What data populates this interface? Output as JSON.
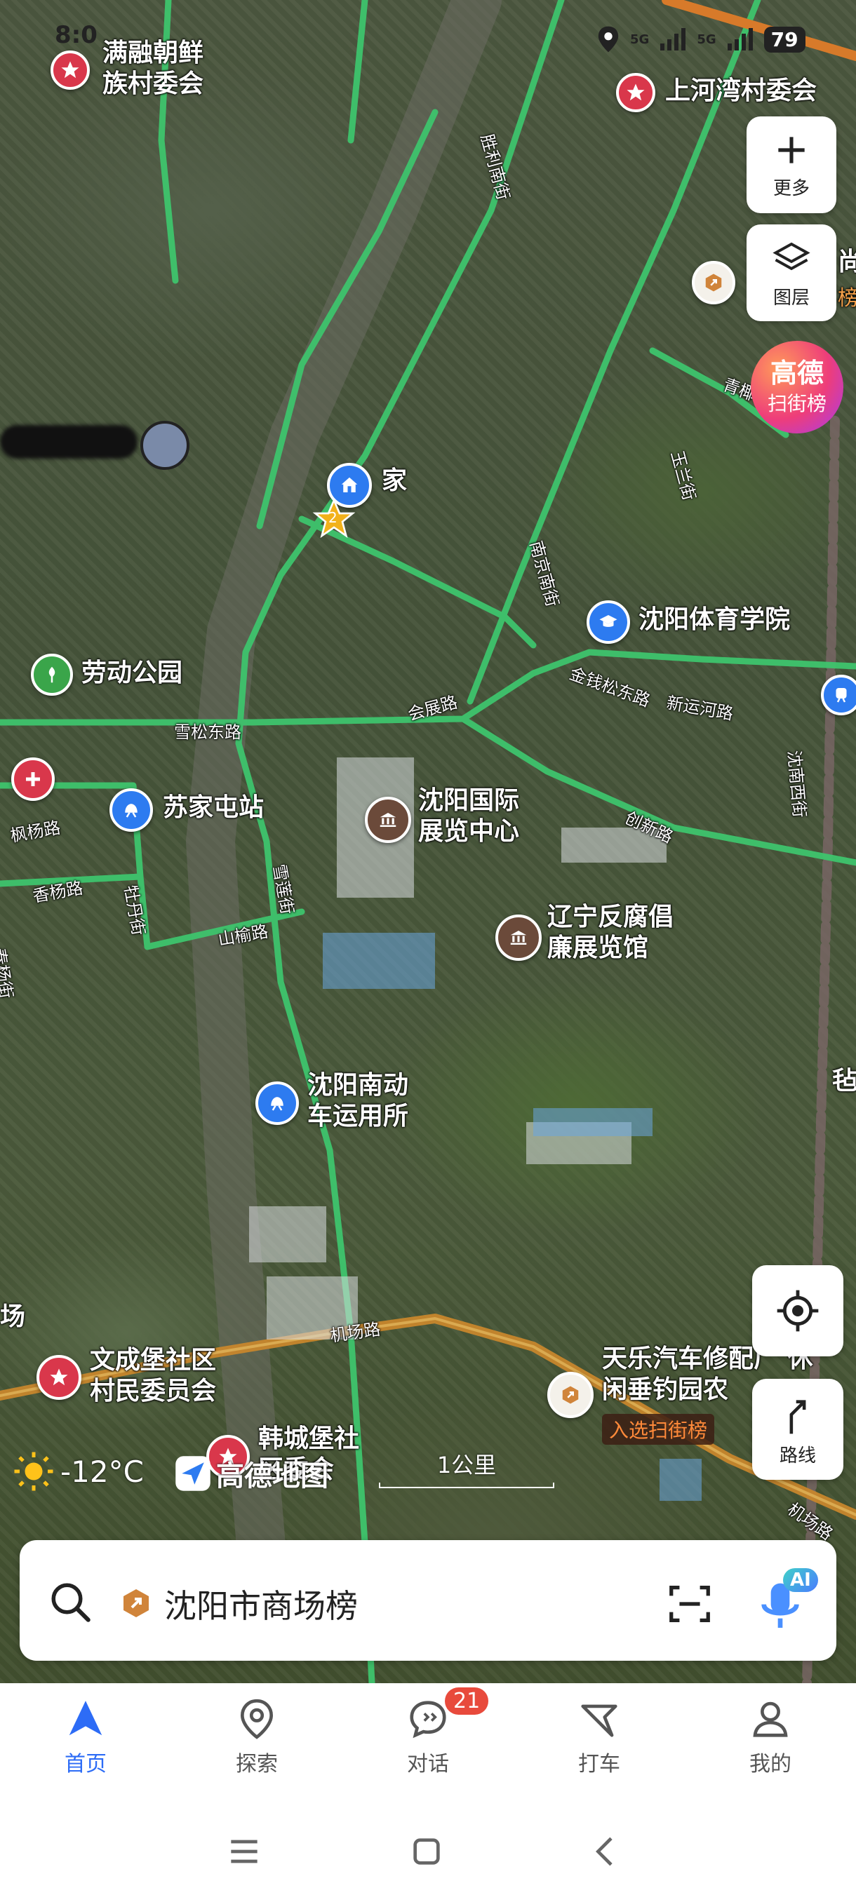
{
  "status_bar": {
    "time": "8:0",
    "signal_labels": [
      "5G",
      "5G"
    ],
    "battery": "79"
  },
  "map_controls": {
    "more_label": "更多",
    "layers_label": "图层",
    "ranking_badge_line1": "高德",
    "ranking_badge_line2": "扫街榜",
    "route_label": "路线"
  },
  "pois": {
    "manrong": "满融朝鲜\n族村委会",
    "shanghewan": "上河湾村委会",
    "home": "家",
    "home_badge": "2",
    "sports_univ": "沈阳体育学院",
    "labor_park": "劳动公园",
    "sujiatun": "苏家屯站",
    "expo": "沈阳国际\n展览中心",
    "anticorruption": "辽宁反腐倡\n廉展览馆",
    "south_depot": "沈阳南动\n车运用所",
    "wenchengbao": "文成堡社区\n村民委员会",
    "hanchengbao": "韩城堡社\n区委会",
    "tianle": "天乐汽车修配厂 休\n闲垂钓园农",
    "tianle_tag": "入选扫街榜",
    "edge_ju": "尚",
    "edge_bang": "榜",
    "edge_chang": "场",
    "edge_zhan": "毡"
  },
  "roads": {
    "shengli": "胜利南街",
    "qingliu": "青椰路",
    "yulan": "玉兰街",
    "nanjing": "南京南街",
    "jinqiansong": "金钱松东路",
    "xinyunhe": "新运河路",
    "huizhan": "会展路",
    "xuesong": "雪松东路",
    "fengyang": "枫杨路",
    "xiangyang": "香杨路",
    "mudan": "牡丹街",
    "shanyu": "山榆路",
    "xuelian": "雪莲街",
    "chuangxin": "创新路",
    "shenyang_west": "沈南西街",
    "airport": "机场路",
    "airport2": "机场路",
    "chunyang": "春杨街"
  },
  "overlay": {
    "temperature": "-12°C",
    "logo_text": "高德地图",
    "scale_text": "1公里"
  },
  "search": {
    "placeholder": "沈阳市商场榜",
    "ai_badge": "AI"
  },
  "tabs": [
    {
      "label": "首页",
      "active": true
    },
    {
      "label": "探索",
      "active": false
    },
    {
      "label": "对话",
      "active": false,
      "badge": "21"
    },
    {
      "label": "打车",
      "active": false
    },
    {
      "label": "我的",
      "active": false
    }
  ],
  "colors": {
    "accent": "#2d6cf6",
    "road": "#3ec46d",
    "highway": "#c7862c",
    "pin_red": "#d9374b",
    "pin_blue": "#2d7bf0",
    "pin_brown": "#6b4a3a",
    "pin_green": "#3aa54a",
    "badge_red": "#e84a3c"
  }
}
